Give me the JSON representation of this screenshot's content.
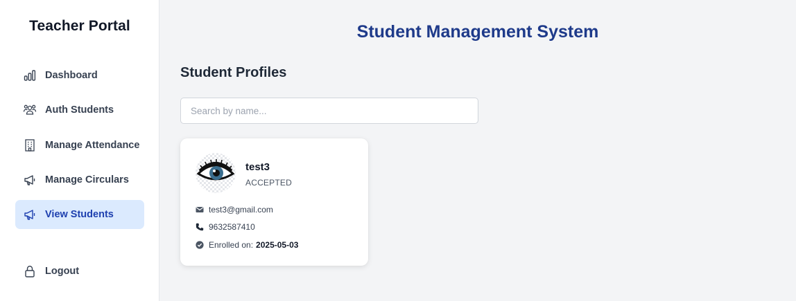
{
  "sidebar": {
    "brand": "Teacher Portal",
    "items": [
      {
        "label": "Dashboard",
        "icon": "bar-chart-icon"
      },
      {
        "label": "Auth Students",
        "icon": "users-icon"
      },
      {
        "label": "Manage Attendance",
        "icon": "building-icon"
      },
      {
        "label": "Manage Circulars",
        "icon": "megaphone-icon"
      },
      {
        "label": "View Students",
        "icon": "megaphone-icon",
        "active": true
      }
    ],
    "logout": {
      "label": "Logout",
      "icon": "lock-icon"
    }
  },
  "header": {
    "title": "Student Management System"
  },
  "main": {
    "section_title": "Student Profiles",
    "search": {
      "placeholder": "Search by name...",
      "value": ""
    },
    "students": [
      {
        "name": "test3",
        "status": "ACCEPTED",
        "email": "test3@gmail.com",
        "phone": "9632587410",
        "enrolled_label": "Enrolled on:",
        "enrolled_date": "2025-05-03"
      }
    ]
  },
  "colors": {
    "accent": "#1e40af",
    "title": "#1e3a8a",
    "active_bg": "#dbeafe",
    "page_bg": "#f3f4f6"
  }
}
